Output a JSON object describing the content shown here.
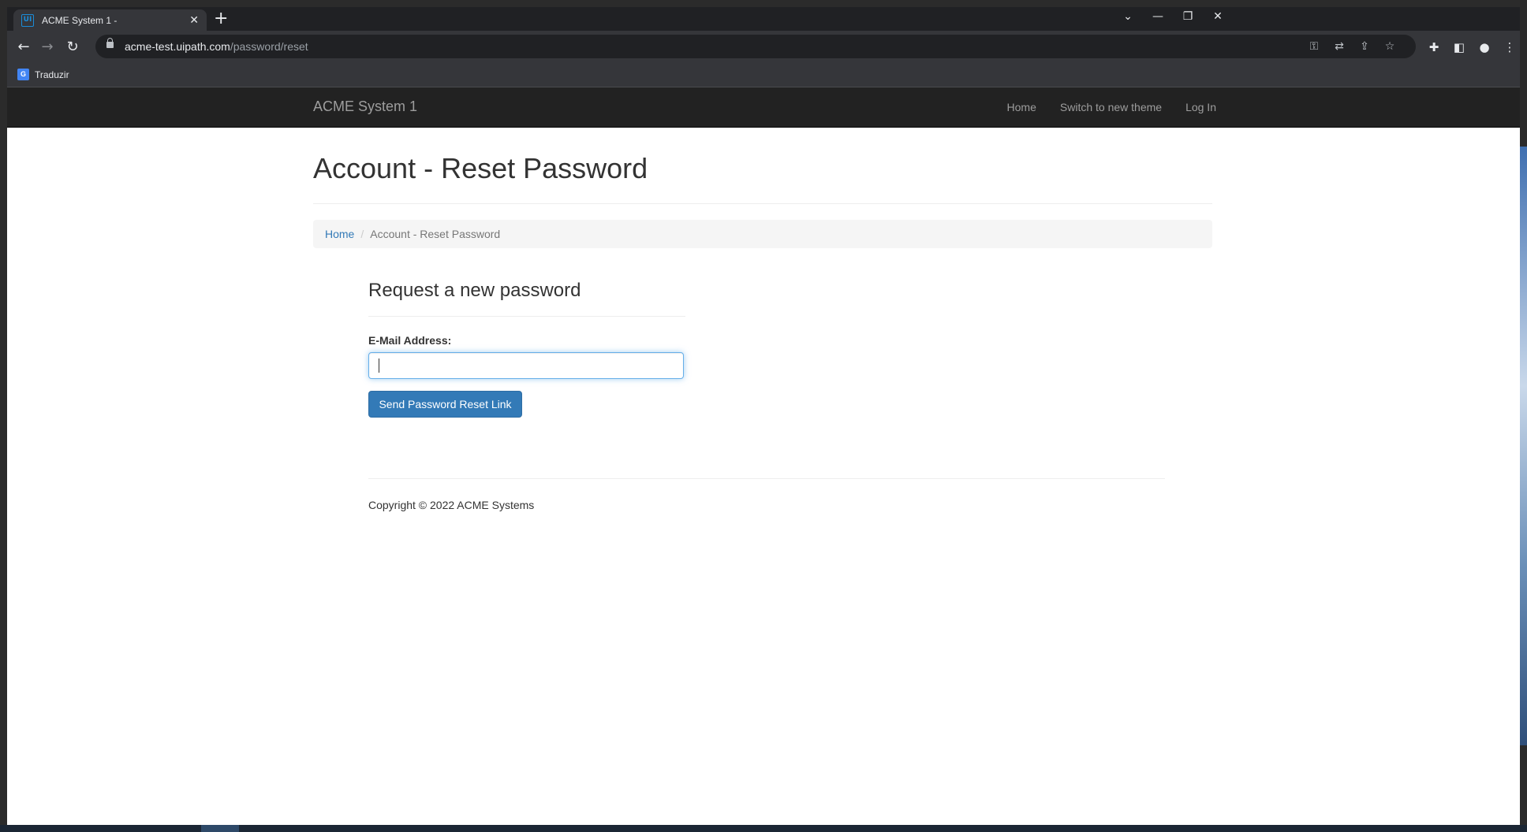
{
  "browser": {
    "tab_title": "ACME System 1 -",
    "favicon_text": "UI",
    "close_tab_glyph": "✕",
    "new_tab_glyph": "+",
    "url_host": "acme-test.uipath.com",
    "url_path": "/password/reset",
    "bookmark_label": "Traduzir",
    "bookmark_icon_text": "G"
  },
  "site": {
    "brand": "ACME System 1",
    "nav": {
      "home": "Home",
      "switch_theme": "Switch to new theme",
      "login": "Log In"
    }
  },
  "page": {
    "title": "Account - Reset Password",
    "breadcrumb": {
      "home": "Home",
      "separator": "/",
      "current": "Account - Reset Password"
    },
    "form": {
      "title": "Request a new password",
      "email_label": "E-Mail Address:",
      "email_value": "",
      "submit_label": "Send Password Reset Link"
    },
    "footer": {
      "copyright": "Copyright © 2022 ACME Systems"
    }
  },
  "colors": {
    "navbar_bg": "#222222",
    "link": "#337ab7",
    "primary_button": "#337ab7",
    "input_focus": "#66afe9"
  }
}
